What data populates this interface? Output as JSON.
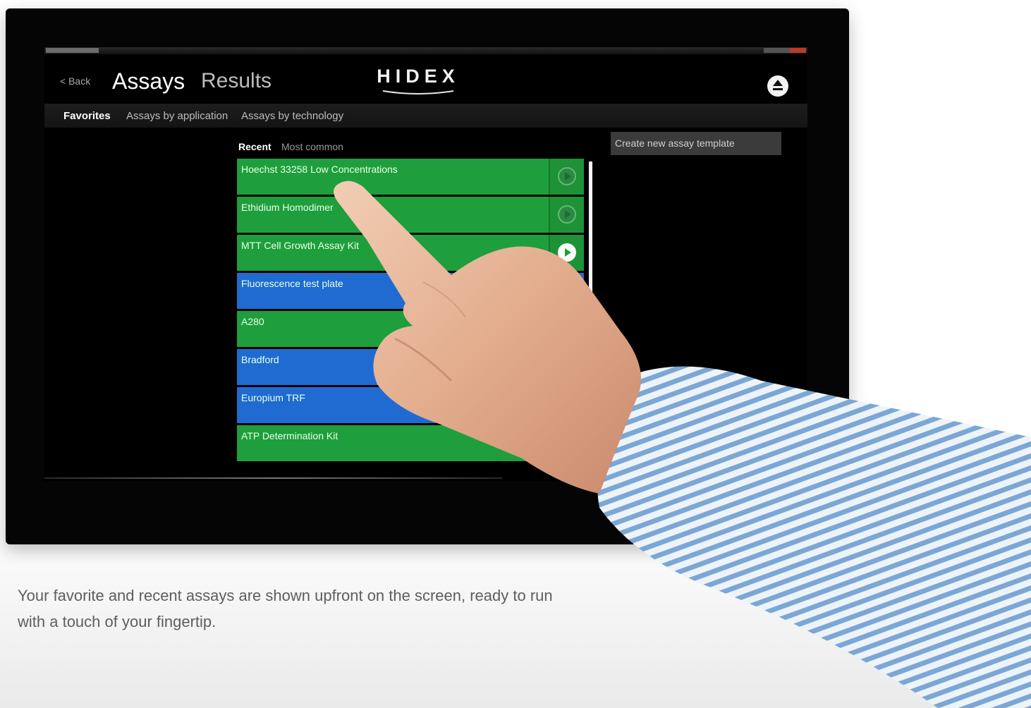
{
  "header": {
    "back_label": "< Back",
    "tab_assays": "Assays",
    "tab_results": "Results",
    "logo_text": "HIDEX"
  },
  "subnav": {
    "items": [
      "Favorites",
      "Assays by application",
      "Assays by technology"
    ],
    "active": "Favorites"
  },
  "filters": {
    "items": [
      "Recent",
      "Most common"
    ],
    "active": "Recent"
  },
  "create_button_label": "Create new assay template",
  "assays": [
    {
      "name": "Hoechst 33258 Low Concentrations",
      "color": "green"
    },
    {
      "name": "Ethidium Homodimer",
      "color": "green"
    },
    {
      "name": "MTT Cell Growth Assay Kit",
      "color": "green"
    },
    {
      "name": "Fluorescence test plate",
      "color": "blue"
    },
    {
      "name": "A280",
      "color": "green"
    },
    {
      "name": "Bradford",
      "color": "blue"
    },
    {
      "name": "Europium TRF",
      "color": "blue"
    },
    {
      "name": "ATP Determination Kit",
      "color": "green"
    }
  ],
  "caption": "Your favorite and recent assays are shown upfront on the screen, ready to run with a touch of your fingertip.",
  "colors": {
    "green": "#1e9e3c",
    "blue": "#1f6bd1",
    "background": "#000000"
  },
  "icons": {
    "play": "play-circle-icon",
    "eject": "eject-icon"
  }
}
